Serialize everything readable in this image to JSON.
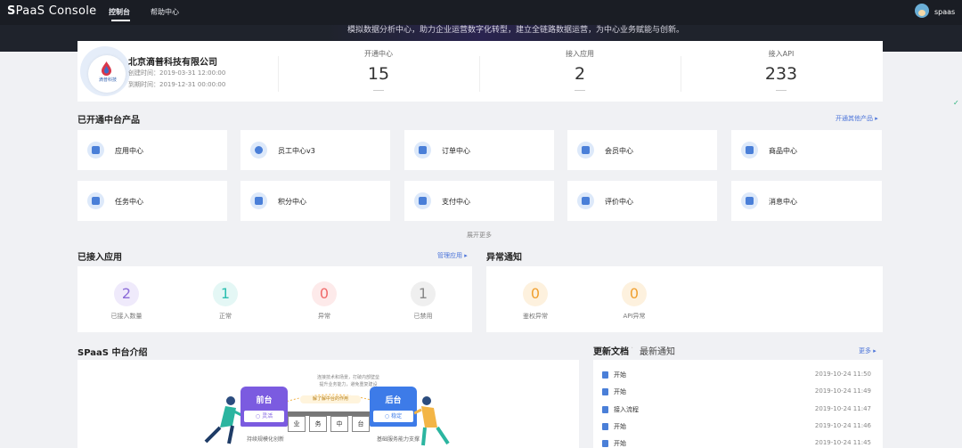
{
  "app": {
    "logo_icon": "S",
    "logo_name": "PaaS Console"
  },
  "nav": {
    "items": [
      "控制台",
      "帮助中心"
    ]
  },
  "user": {
    "name": "spaas"
  },
  "banner": {
    "text": "模拟数据分析中心，助力企业运营数字化转型，建立全链路数据运营，为中心业务赋能与创新。"
  },
  "company": {
    "name": "北京滴普科技有限公司",
    "logo_text": "滴普科技",
    "created": "创建时间：2019-03-31 12:00:00",
    "expires": "到期时间：2019-12-31 00:00:00",
    "stats": [
      {
        "label": "开通中心",
        "value": "15"
      },
      {
        "label": "接入应用",
        "value": "2"
      },
      {
        "label": "接入API",
        "value": "233"
      }
    ]
  },
  "products": {
    "title": "已开通中台产品",
    "more": "开通其他产品",
    "items": [
      "应用中心",
      "员工中心v3",
      "订单中心",
      "会员中心",
      "商品中心",
      "任务中心",
      "积分中心",
      "支付中心",
      "评价中心",
      "消息中心"
    ],
    "expand": "展开更多"
  },
  "apps": {
    "title": "已接入应用",
    "manage": "管理应用",
    "stats": [
      {
        "value": "2",
        "label": "已接入数量",
        "color": "#8b6bd8",
        "bg": "#efeafb"
      },
      {
        "value": "1",
        "label": "正常",
        "color": "#2bbfb0",
        "bg": "#e4f7f5"
      },
      {
        "value": "0",
        "label": "异常",
        "color": "#f06a6a",
        "bg": "#fdeaea"
      },
      {
        "value": "1",
        "label": "已禁用",
        "color": "#888888",
        "bg": "#efefef"
      }
    ]
  },
  "alerts": {
    "title": "异常通知",
    "stats": [
      {
        "value": "0",
        "label": "鉴权异常",
        "color": "#f0a030",
        "bg": "#fdf1de"
      },
      {
        "value": "0",
        "label": "API异常",
        "color": "#f0a030",
        "bg": "#fdf1de"
      }
    ]
  },
  "intro": {
    "title": "SPaaS 中台介绍",
    "note1": "连接技术和场景，打破内部壁垒",
    "note2": "提升业务能力，避免重复建设",
    "arc_label": "解了解中台的作用",
    "front": "前台",
    "front_tag": "灵活",
    "back": "后台",
    "back_tag": "稳定",
    "blocks": [
      "业",
      "务",
      "中",
      "台"
    ],
    "caption_left": "持续规模化创新",
    "caption_right": "基础服务能力支撑"
  },
  "news": {
    "tab_docs": "更新文档",
    "tab_notice": "最新通知",
    "more": "更多",
    "items": [
      {
        "title": "开始",
        "date": "2019-10-24 11:50"
      },
      {
        "title": "开始",
        "date": "2019-10-24 11:49"
      },
      {
        "title": "接入流程",
        "date": "2019-10-24 11:47"
      },
      {
        "title": "开始",
        "date": "2019-10-24 11:46"
      },
      {
        "title": "开始",
        "date": "2019-10-24 11:45"
      }
    ]
  }
}
